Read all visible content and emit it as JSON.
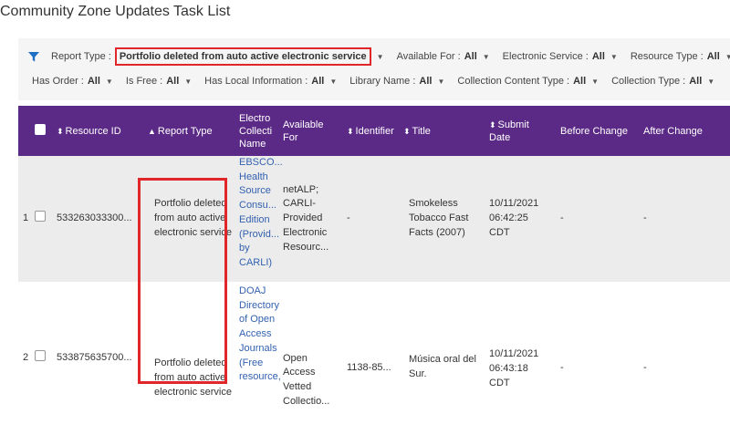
{
  "page": {
    "title": "Community Zone Updates Task List"
  },
  "filters": {
    "row1": [
      {
        "label": "Report Type :",
        "value": "Portfolio deleted from auto active electronic service",
        "highlighted": true
      },
      {
        "label": "Available For :",
        "value": "All"
      },
      {
        "label": "Electronic Service :",
        "value": "All"
      },
      {
        "label": "Resource Type :",
        "value": "All"
      }
    ],
    "row2": [
      {
        "label": "Has Order :",
        "value": "All"
      },
      {
        "label": "Is Free :",
        "value": "All"
      },
      {
        "label": "Has Local Information :",
        "value": "All"
      },
      {
        "label": "Library Name :",
        "value": "All"
      },
      {
        "label": "Collection Content Type :",
        "value": "All"
      },
      {
        "label": "Collection Type :",
        "value": "All"
      }
    ]
  },
  "table": {
    "columns": {
      "resource_id": "Resource ID",
      "report_type": "Report Type",
      "collection_name": "Electro\nCollecti\nName",
      "available_for": "Available\nFor",
      "identifier": "Identifier",
      "title": "Title",
      "submit_date": "Submit\nDate",
      "before_change": "Before Change",
      "after_change": "After Change"
    },
    "rows": [
      {
        "index": "1",
        "resource_id": "533263033300...",
        "report_type": "Portfolio deleted\nfrom auto active\nelectronic service",
        "collection_name": "EBSCO...\nHealth\nSource\nConsu...\nEdition\n(Provid...\nby\nCARLI)",
        "available_for": "netALP;\nCARLI-\nProvided\nElectronic\nResourc...",
        "identifier": "-",
        "title": "Smokeless\nTobacco Fast\nFacts (2007)",
        "submit_date": "10/11/2021\n06:42:25\nCDT",
        "before_change": "-",
        "after_change": "-"
      },
      {
        "index": "2",
        "resource_id": "533875635700...",
        "report_type": "Portfolio deleted\nfrom auto active\nelectronic service",
        "collection_name": "DOAJ\nDirectory\nof Open\nAccess\nJournals\n(Free\nresource,",
        "available_for": "Open\nAccess\nVetted\nCollectio...",
        "identifier": "1138-85...",
        "title": "Música oral del\nSur.",
        "submit_date": "10/11/2021\n06:43:18\nCDT",
        "before_change": "-",
        "after_change": "-"
      }
    ]
  },
  "colors": {
    "header_bg": "#5b2a86",
    "highlight": "#e0252b",
    "link": "#3361b0"
  },
  "icons": {
    "filter": "funnel-icon",
    "sort": "sort-icon",
    "dropdown": "caret-down-icon"
  }
}
